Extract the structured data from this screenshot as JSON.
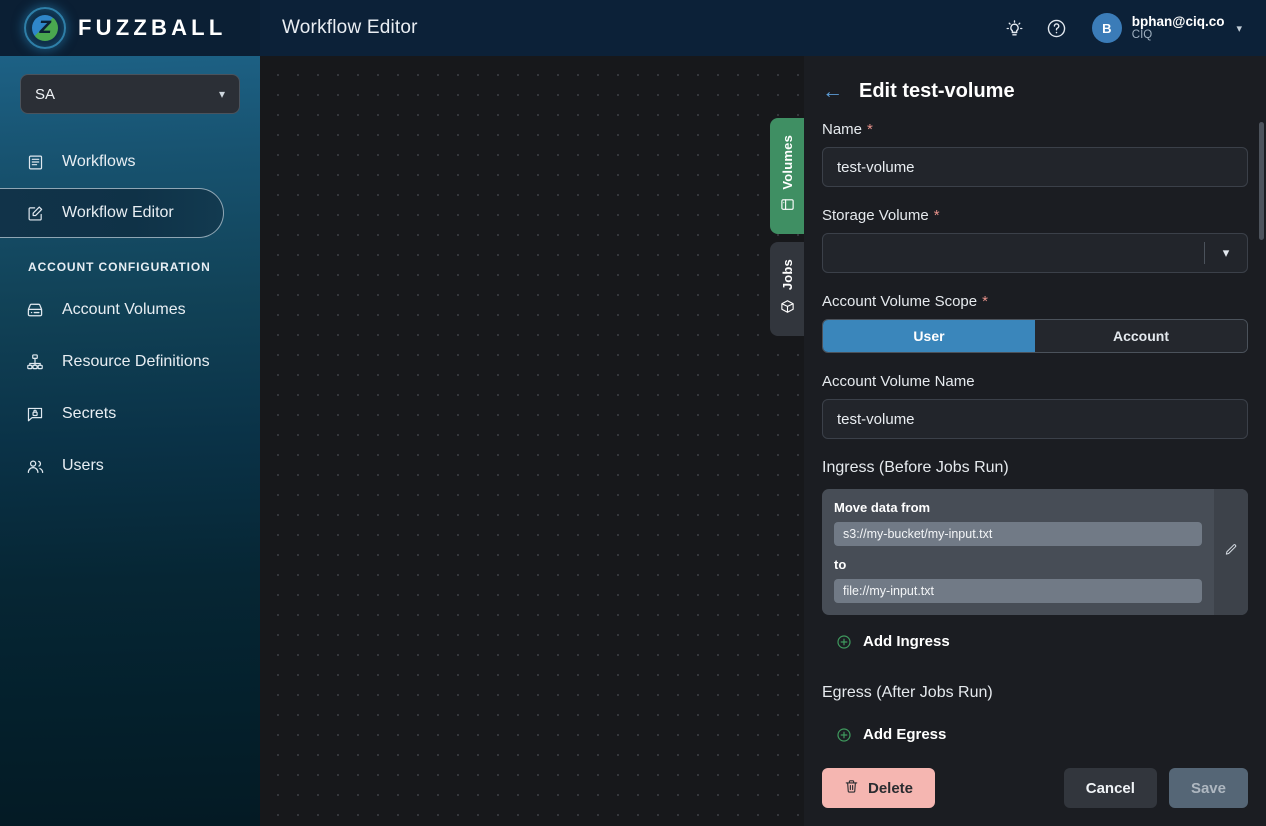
{
  "brand": {
    "name": "FUZZBALL",
    "logo_letter": "Z",
    "logo_icon": "fuzzball-logo-icon"
  },
  "topbar": {
    "title": "Workflow Editor",
    "lightbulb_icon": "lightbulb-icon",
    "help_icon": "help-circle-icon",
    "user": {
      "email": "bphan@ciq.co",
      "org": "CIQ",
      "initial": "B"
    }
  },
  "sidebar": {
    "account_selector": {
      "value": "SA"
    },
    "items": [
      {
        "label": "Workflows",
        "icon": "list-icon",
        "active": false
      },
      {
        "label": "Workflow Editor",
        "icon": "edit-square-icon",
        "active": true
      }
    ],
    "section_title": "ACCOUNT CONFIGURATION",
    "config_items": [
      {
        "label": "Account Volumes",
        "icon": "hard-drive-icon"
      },
      {
        "label": "Resource Definitions",
        "icon": "sitemap-icon"
      },
      {
        "label": "Secrets",
        "icon": "secret-lock-icon"
      },
      {
        "label": "Users",
        "icon": "users-icon"
      }
    ]
  },
  "vertical_tabs": [
    {
      "label": "Volumes",
      "icon": "drive-icon",
      "active": true
    },
    {
      "label": "Jobs",
      "icon": "cube-icon",
      "active": false
    }
  ],
  "panel": {
    "title": "Edit test-volume",
    "back_icon": "arrow-left-icon",
    "name": {
      "label": "Name",
      "required": true,
      "value": "test-volume"
    },
    "storage_volume": {
      "label": "Storage Volume",
      "required": true,
      "value": "",
      "caret_icon": "chevron-down-icon"
    },
    "scope": {
      "label": "Account Volume Scope",
      "required": true,
      "options": [
        "User",
        "Account"
      ],
      "selected": "User"
    },
    "account_volume_name": {
      "label": "Account Volume Name",
      "required": false,
      "value": "test-volume"
    },
    "ingress": {
      "heading": "Ingress (Before Jobs Run)",
      "entries": [
        {
          "from_label": "Move data from",
          "from_value": "s3://my-bucket/my-input.txt",
          "to_label": "to",
          "to_value": "file://my-input.txt",
          "edit_icon": "pencil-icon"
        }
      ],
      "add_label": "Add Ingress",
      "add_icon": "plus-circle-icon"
    },
    "egress": {
      "heading": "Egress (After Jobs Run)",
      "entries": [],
      "add_label": "Add Egress",
      "add_icon": "plus-circle-icon"
    },
    "footer": {
      "delete_label": "Delete",
      "delete_icon": "trash-icon",
      "cancel_label": "Cancel",
      "save_label": "Save"
    }
  },
  "colors": {
    "accent_blue": "#3a86bb",
    "brand_navy": "#0c2138",
    "green_tab": "#3f8f63",
    "delete_pink": "#f5b6b1",
    "required_star": "#e8928b",
    "add_green": "#3f9a5e"
  }
}
